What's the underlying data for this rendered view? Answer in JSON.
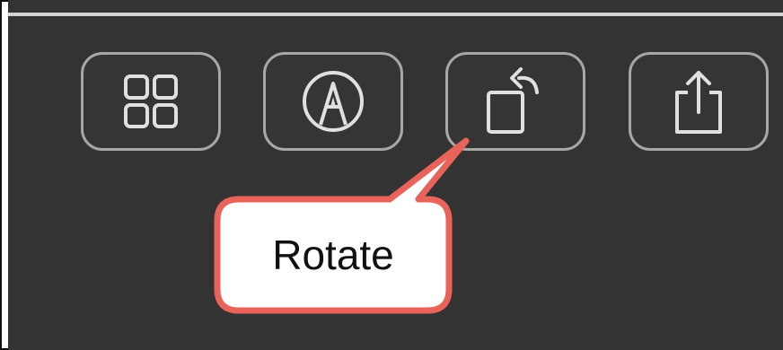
{
  "toolbar": {
    "buttons": [
      {
        "id": "grid",
        "icon": "grid-icon"
      },
      {
        "id": "markup",
        "icon": "markup-pen-icon"
      },
      {
        "id": "rotate",
        "icon": "rotate-icon"
      },
      {
        "id": "share",
        "icon": "share-icon"
      }
    ]
  },
  "callout": {
    "label": "Rotate",
    "border_color": "#e8635a",
    "fill_color": "#ffffff"
  },
  "colors": {
    "toolbar_bg": "#333333",
    "button_border": "#a7a7a7",
    "icon_stroke": "#e0e0e0"
  }
}
